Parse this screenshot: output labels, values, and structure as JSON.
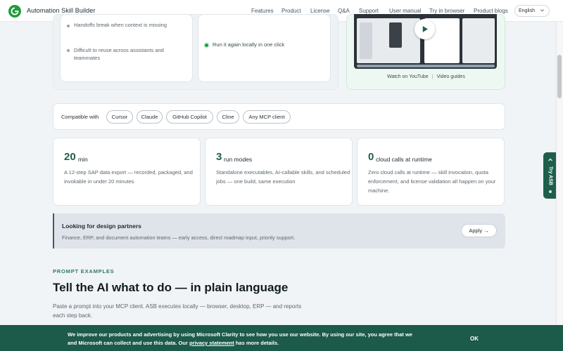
{
  "header": {
    "brand": "Automation Skill Builder",
    "nav": [
      "Features",
      "Product",
      "License",
      "Q&A",
      "Support",
      "User manual",
      "Try in browser",
      "Product blogs"
    ],
    "language": "English"
  },
  "problems": {
    "items": [
      "Handoffs break when context is missing",
      "Difficult to reuse across assistants and teammates"
    ]
  },
  "solution": {
    "item": "Run it again locally in one click"
  },
  "video": {
    "watch_label": "Watch on YouTube",
    "separator": "|",
    "guides_label": "Video guides"
  },
  "compat": {
    "label": "Compatible with",
    "chips": [
      "Cursor",
      "Claude",
      "GitHub Copilot",
      "Cline",
      "Any MCP client"
    ]
  },
  "stats": [
    {
      "number": "20",
      "unit": "min",
      "desc": "A 12-step SAP data export — recorded, packaged, and invokable in under 20 minutes"
    },
    {
      "number": "3",
      "unit": "run modes",
      "desc": "Standalone executables, AI-callable skills, and scheduled jobs — one build, same execution"
    },
    {
      "number": "0",
      "unit": "cloud calls at runtime",
      "desc": "Zero cloud calls at runtime — skill invocation, quota enforcement, and license validation all happen on your machine."
    }
  ],
  "partners": {
    "title": "Looking for design partners",
    "desc": "Finance, ERP, and document automation teams — early access, direct roadmap input, priority support.",
    "apply_label": "Apply →"
  },
  "prompts": {
    "eyebrow": "PROMPT EXAMPLES",
    "headline": "Tell the AI what to do — in plain language",
    "lead": "Paste a prompt into your MCP client. ASB executes locally — browser, desktop, ERP — and reports each step back."
  },
  "side_tab": {
    "label": "Try ASB"
  },
  "cookie": {
    "text_before": "We improve our products and advertising by using Microsoft Clarity to see how you use our website. By using our site, you agree that we and Microsoft can collect and use this data. Our ",
    "link": "privacy statement",
    "text_after": " has more details.",
    "ok_label": "OK"
  },
  "colors": {
    "brand_green": "#1e9c3c",
    "accent_dark": "#1d5f4b",
    "cookie_bg": "#1c5a4a"
  }
}
